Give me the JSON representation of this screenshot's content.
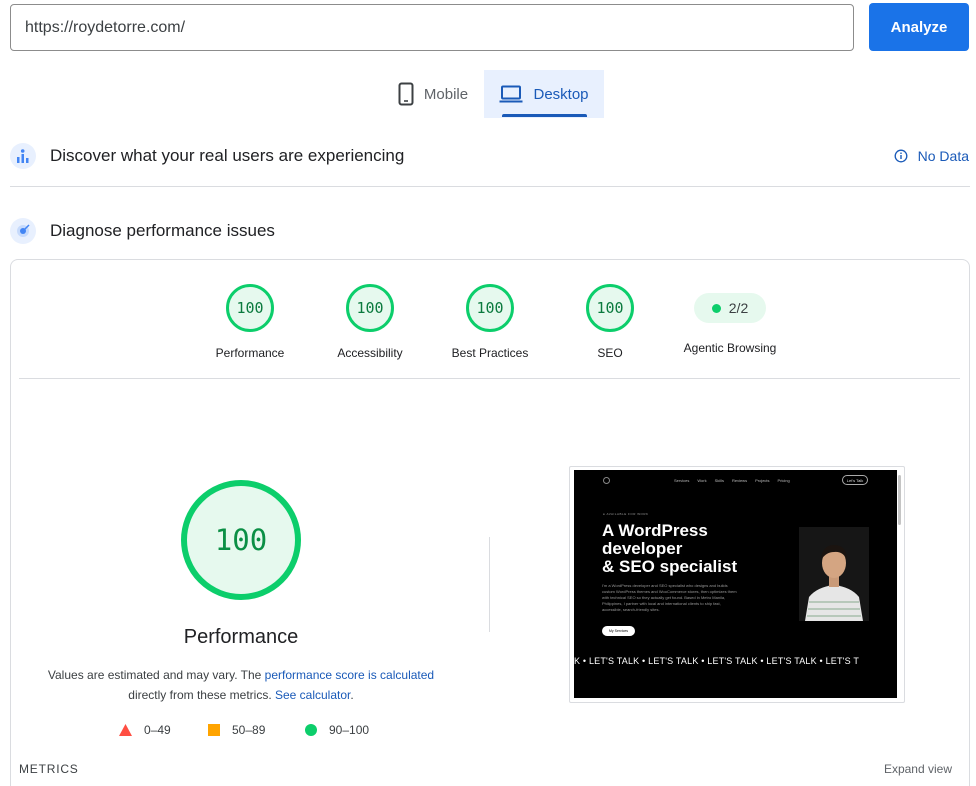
{
  "search": {
    "url_value": "https://roydetorre.com/",
    "analyze_label": "Analyze"
  },
  "tabs": [
    {
      "label": "Mobile",
      "icon": "smartphone-icon",
      "selected": false
    },
    {
      "label": "Desktop",
      "icon": "laptop-icon",
      "selected": true
    }
  ],
  "field_data": {
    "title": "Discover what your real users are experiencing",
    "status": "No Data",
    "icon": "users-chart-icon"
  },
  "diagnose": {
    "title": "Diagnose performance issues",
    "icon": "lighthouse-icon"
  },
  "scores": [
    {
      "label": "Performance",
      "value": "100"
    },
    {
      "label": "Accessibility",
      "value": "100"
    },
    {
      "label": "Best Practices",
      "value": "100"
    },
    {
      "label": "SEO",
      "value": "100"
    }
  ],
  "agentic": {
    "label": "Agentic Browsing",
    "value": "2/2"
  },
  "performance": {
    "score": "100",
    "label": "Performance",
    "note_prefix": "Values are estimated and may vary. The ",
    "note_link1": "performance score is calculated",
    "note_mid": " directly from these metrics. ",
    "note_link2": "See calculator",
    "note_suffix": "."
  },
  "legend": [
    {
      "range": "0–49",
      "color": "#ff4e42",
      "shape": "triangle"
    },
    {
      "range": "50–89",
      "color": "#ffa400",
      "shape": "square"
    },
    {
      "range": "90–100",
      "color": "#0cce6b",
      "shape": "circle"
    }
  ],
  "metrics": {
    "title": "METRICS",
    "expand_label": "Expand view"
  },
  "preview": {
    "nav": [
      "Services",
      "Work",
      "Skills",
      "Reviews",
      "Projects",
      "Pricing"
    ],
    "cta": "Let's Talk",
    "eyebrow": "● AVAILABLE FOR WORK",
    "headline_1": "A WordPress",
    "headline_2": "developer",
    "headline_3": "& SEO specialist",
    "body": "I'm a WordPress developer and SEO specialist who designs and builds custom WordPress themes and WooCommerce stores, then optimizes them with technical SEO so they actually get found. Based in Metro Manila, Philippines, I partner with local and international clients to ship fast, accessible, search-friendly sites.",
    "button": "My Services",
    "ticker": "K  •  LET'S TALK  •  LET'S TALK  •  LET'S TALK  •  LET'S TALK  •  LET'S T"
  },
  "colors": {
    "accent": "#1a73e8",
    "pass": "#0cce6b",
    "link": "#1a5ab8"
  }
}
